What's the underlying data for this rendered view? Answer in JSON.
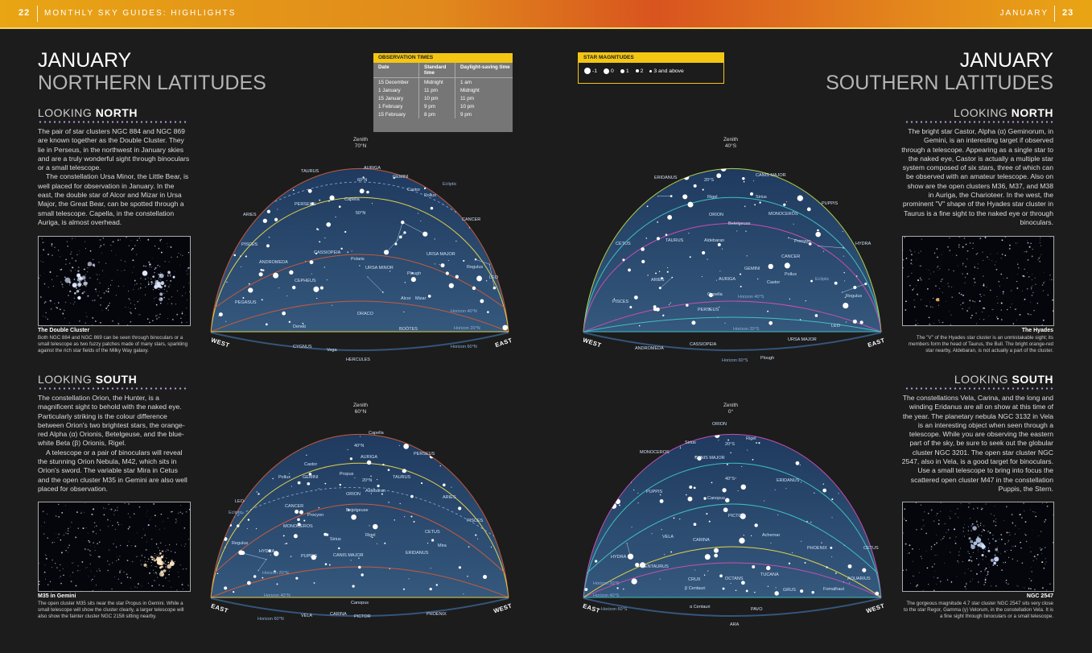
{
  "header": {
    "left_page_number": "22",
    "left_running_title": "MONTHLY SKY GUIDES: HIGHLIGHTS",
    "right_running_title": "JANUARY",
    "right_page_number": "23"
  },
  "left_page": {
    "title": "JANUARY",
    "subtitle": "NORTHERN LATITUDES",
    "north": {
      "heading_light": "LOOKING",
      "heading_bold": "NORTH",
      "paragraphs": [
        "The pair of star clusters NGC 884 and NGC 869 are known together as the Double Cluster. They lie in Perseus, in the northwest in January skies and are a truly wonderful sight through binoculars or a small telescope.",
        "The constellation Ursa Minor, the Little Bear, is well placed for observation in January. In the east, the double star of Alcor and Mizar in Ursa Major, the Great Bear, can be spotted through a small telescope. Capella, in the constellation Auriga, is almost overhead."
      ],
      "photo_title": "The Double Cluster",
      "photo_caption": "Both NGC 884 and NGC 869 can be seen through binoculars or a small telescope as two fuzzy patches made of many stars, sparkling against the rich star fields of the Milky Way galaxy."
    },
    "south": {
      "heading_light": "LOOKING",
      "heading_bold": "SOUTH",
      "paragraphs": [
        "The constellation Orion, the Hunter, is a magnificent sight to behold with the naked eye. Particularly striking is the colour difference between Orion's two brightest stars, the orange-red Alpha (α) Orionis, Betelgeuse, and the blue-white Beta (β) Orionis, Rigel.",
        "A telescope or a pair of binoculars will reveal the stunning Orion Nebula, M42, which sits in Orion's sword. The variable star Mira in Cetus and the open cluster M35 in Gemini are also well placed for observation."
      ],
      "photo_title": "M35 in Gemini",
      "photo_caption": "The open cluster M35 sits near the star Propus in Gemini. While a small telescope will show the cluster clearly, a larger telescope will also show the fainter cluster NGC 2158 sitting nearby."
    }
  },
  "observation_times": {
    "title": "OBSERVATION TIMES",
    "columns": [
      "Date",
      "Standard time",
      "Daylight-saving time"
    ],
    "rows": [
      [
        "15 December",
        "Midnight",
        "1 am"
      ],
      [
        "1 January",
        "11 pm",
        "Midnight"
      ],
      [
        "15 January",
        "10 pm",
        "11 pm"
      ],
      [
        "1 February",
        "9 pm",
        "10 pm"
      ],
      [
        "15 February",
        "8 pm",
        "9 pm"
      ]
    ]
  },
  "star_magnitudes": {
    "title": "STAR MAGNITUDES",
    "labels": [
      "-1",
      "0",
      "1",
      "2",
      "3 and above"
    ]
  },
  "maps": {
    "nn": {
      "zenith": [
        "Zenith",
        "70°N"
      ],
      "left_dir": "WEST",
      "right_dir": "EAST",
      "labels": {
        "taurus": "TAURUS",
        "auriga": "AURIGA",
        "gemini": "GEMINI",
        "lat_a": "60°N",
        "lat_b": "50°N",
        "capella": "Capella",
        "castor": "Castor",
        "pollux": "Pollux",
        "aries": "ARIES",
        "perseus": "PERSEUS",
        "cancer": "CANCER",
        "pisces": "PISCES",
        "cassiopeia": "CASSIOPEIA",
        "polaris": "Polaris",
        "ursa_minor": "URSA MINOR",
        "ursa_major": "URSA MAJOR",
        "andromeda": "ANDROMEDA",
        "cepheus": "CEPHEUS",
        "regulus": "Regulus",
        "leo": "LEO",
        "plough": "Plough",
        "pegasus": "PEGASUS",
        "draco": "DRACO",
        "alcor": "Alcor",
        "mizar": "Mizar",
        "hz_a": "Horizon 40°N",
        "hz_b": "Horizon 20°N",
        "hz_c": "Horizon 60°N",
        "deneb": "Deneb",
        "bootes": "BOÖTES",
        "cygnus": "CYGNUS",
        "vega": "Vega",
        "hercules": "HERCULES",
        "ecliptic": "Ecliptic"
      }
    },
    "ns": {
      "zenith": [
        "Zenith",
        "60°N"
      ],
      "left_dir": "EAST",
      "right_dir": "WEST",
      "labels": {
        "capella": "Capella",
        "lat_a": "40°N",
        "auriga": "AURIGA",
        "perseus": "PERSEUS",
        "castor": "Castor",
        "propus": "Propus",
        "pollux": "Pollux",
        "gemini": "GEMINI",
        "lat_b": "20°N",
        "taurus": "TAURUS",
        "leo": "LEO",
        "orion": "ORION",
        "aldebaran": "Aldebaran",
        "aries": "ARIES",
        "cancer": "CANCER",
        "procyon": "Procyon",
        "betelgeuse": "Betelgeuse",
        "pisces": "PISCES",
        "monoceros": "MONOCEROS",
        "sirius": "Sirius",
        "rigel": "Rigel",
        "cetus": "CETUS",
        "regulus": "Regulus",
        "hydra": "HYDRA",
        "canis_major": "CANIS MAJOR",
        "mira": "Mira",
        "puppis": "PUPPIS",
        "eridanus": "ERIDANUS",
        "hz_a": "Horizon 20°N",
        "hz_b": "Horizon 40°N",
        "canopus": "Canopus",
        "vela": "VELA",
        "carina": "CARINA",
        "pictor": "PICTOR",
        "phoenix": "PHOENIX",
        "hz_c": "Horizon 60°N",
        "ecliptic": "Ecliptic"
      }
    },
    "sn": {
      "zenith": [
        "Zenith",
        "40°S"
      ],
      "left_dir": "WEST",
      "right_dir": "EAST",
      "labels": {
        "eridanus": "ERIDANUS",
        "lat_a": "20°S",
        "canis_major": "CANIS MAJOR",
        "puppis": "PUPPIS",
        "rigel": "Rigel",
        "sirius": "Sirius",
        "orion": "ORION",
        "betelgeuse": "Betelgeuse",
        "monoceros": "MONOCEROS",
        "procyon": "Procyon",
        "cetus": "CETUS",
        "taurus": "TAURUS",
        "aldebaran": "Aldebaran",
        "hydra": "HYDRA",
        "cancer": "CANCER",
        "gemini": "GEMINI",
        "pollux": "Pollux",
        "aries": "ARIES",
        "auriga": "AURIGA",
        "castor": "Castor",
        "capella": "Capella",
        "pisces": "PISCES",
        "regulus": "Regulus",
        "perseus": "PERSEUS",
        "hz_a": "Horizon 40°S",
        "hz_b": "Horizon 20°S",
        "hz_c": "Horizon 60°S",
        "ursa_major": "URSA MAJOR",
        "leo": "LEO",
        "andromeda": "ANDROMEDA",
        "cassiopeia": "CASSIOPEIA",
        "plough": "Plough",
        "ecliptic": "Ecliptic"
      }
    },
    "ss": {
      "zenith": [
        "Zenith",
        "0°"
      ],
      "left_dir": "EAST",
      "right_dir": "WEST",
      "labels": {
        "orion": "ORION",
        "rigel": "Rigel",
        "sirius": "Sirius",
        "monoceros": "MONOCEROS",
        "lat_a": "20°S",
        "canis_major": "CANIS MAJOR",
        "lat_b": "40°S",
        "eridanus": "ERIDANUS",
        "puppis": "PUPPIS",
        "canopus": "Canopus",
        "pictor": "PICTOR",
        "vela": "VELA",
        "carina": "CARINA",
        "achernar": "Achernar",
        "phoenix": "PHOENIX",
        "cetus": "CETUS",
        "hydra": "HYDRA",
        "centaurus": "CENTAURUS",
        "crux": "CRUX",
        "b_cen": "β Centauri",
        "octans": "OCTANS",
        "tucana": "TUCANA",
        "aquarius": "AQUARIUS",
        "fomalhaut": "Fomalhaut",
        "grus": "GRUS",
        "a_cen": "α Centauri",
        "pavo": "PAVO",
        "ara": "ARA",
        "hz_a": "Horizon 20°S",
        "hz_b": "Horizon 40°S",
        "hz_c": "Horizon 60°S"
      }
    }
  },
  "right_page": {
    "title": "JANUARY",
    "subtitle": "SOUTHERN LATITUDES",
    "north": {
      "heading_light": "LOOKING",
      "heading_bold": "NORTH",
      "paragraphs": [
        "The bright star Castor, Alpha (α) Geminorum, in Gemini, is an interesting target if observed through a telescope. Appearing as a single star to the naked eye, Castor is actually a multiple star system composed of six stars, three of which can be observed with an amateur telescope. Also on show are the open clusters M36, M37, and M38 in Auriga, the Charioteer. In the west, the prominent \"V\" shape of the Hyades star cluster in Taurus is a fine sight to the naked eye or through binoculars."
      ],
      "photo_title": "The Hyades",
      "photo_caption": "The \"V\" of the Hyades star cluster is an unmistakable sight; its members form the head of Taurus, the Bull. The bright orange-red star nearby, Aldebaran, is not actually a part of the cluster."
    },
    "south": {
      "heading_light": "LOOKING",
      "heading_bold": "SOUTH",
      "paragraphs": [
        "The constellations Vela, Carina, and the long and winding Eridanus are all on show at this time of the year. The planetary nebula NGC 3132 in Vela is an interesting object when seen through a telescope. While you are observing the eastern part of the sky, be sure to seek out the globular cluster NGC 3201. The open star cluster NGC 2547, also in Vela, is a good target for binoculars. Use a small telescope to bring into focus the scattered open cluster M47 in the constellation Puppis, the Stern."
      ],
      "photo_title": "NGC 2547",
      "photo_caption": "The gorgeous magnitude 4.7 star cluster NGC 2547 sits very close to the star Regor, Gamma (γ) Velorum, in the constellation Vela. It is a fine sight through binoculars or a small telescope."
    }
  }
}
